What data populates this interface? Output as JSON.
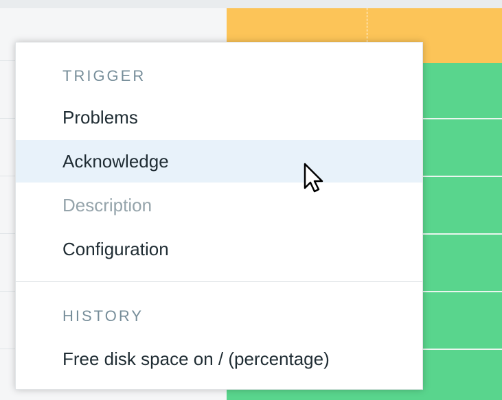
{
  "menu": {
    "sections": [
      {
        "header": "TRIGGER",
        "items": [
          {
            "label": "Problems",
            "enabled": true
          },
          {
            "label": "Acknowledge",
            "enabled": true,
            "hovered": true
          },
          {
            "label": "Description",
            "enabled": false
          },
          {
            "label": "Configuration",
            "enabled": true
          }
        ]
      },
      {
        "header": "HISTORY",
        "items": [
          {
            "label": "Free disk space on / (percentage)",
            "enabled": true
          }
        ]
      }
    ]
  },
  "colors": {
    "warning_cell": "#fcc458",
    "ok_cell": "#59d58d",
    "hover_bg": "#e8f2fa",
    "section_header": "#768d99",
    "disabled_text": "#95a4ab",
    "text": "#1f2c33"
  },
  "cursor": {
    "icon": "arrow-pointer-icon"
  }
}
